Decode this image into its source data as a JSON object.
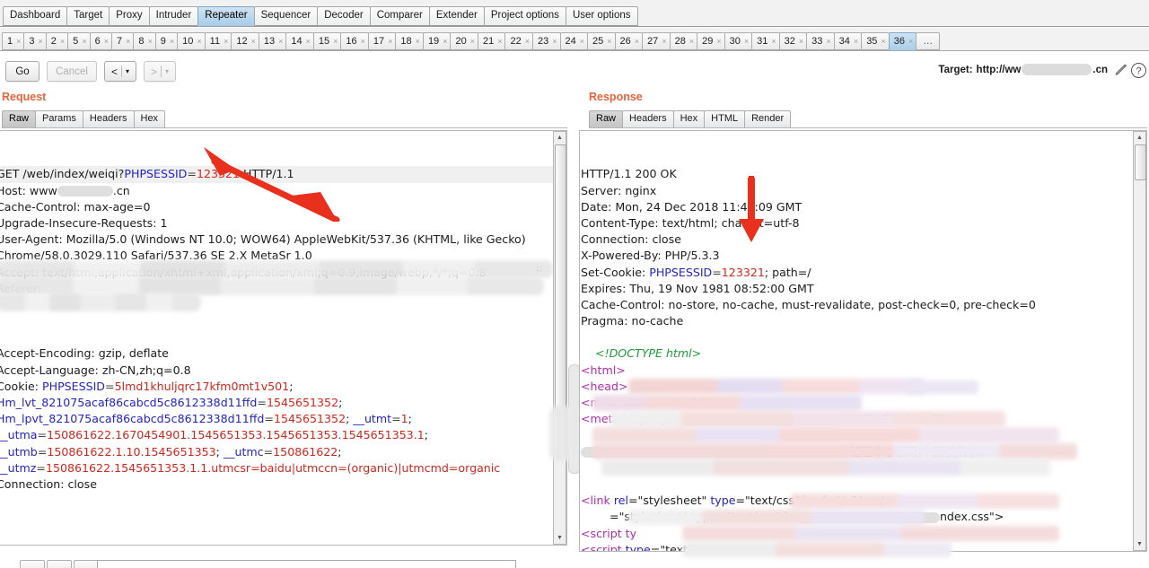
{
  "app": {
    "name": "Burp Suite Repeater"
  },
  "main_tabs": [
    {
      "label": "Dashboard",
      "selected": false
    },
    {
      "label": "Target",
      "selected": false
    },
    {
      "label": "Proxy",
      "selected": false
    },
    {
      "label": "Intruder",
      "selected": false
    },
    {
      "label": "Repeater",
      "selected": true
    },
    {
      "label": "Sequencer",
      "selected": false
    },
    {
      "label": "Decoder",
      "selected": false
    },
    {
      "label": "Comparer",
      "selected": false
    },
    {
      "label": "Extender",
      "selected": false
    },
    {
      "label": "Project options",
      "selected": false
    },
    {
      "label": "User options",
      "selected": false
    }
  ],
  "repeater_tabs": {
    "items": [
      {
        "label": "1",
        "selected": false
      },
      {
        "label": "3",
        "selected": false
      },
      {
        "label": "2",
        "selected": false
      },
      {
        "label": "5",
        "selected": false
      },
      {
        "label": "6",
        "selected": false
      },
      {
        "label": "7",
        "selected": false
      },
      {
        "label": "8",
        "selected": false
      },
      {
        "label": "9",
        "selected": false
      },
      {
        "label": "10",
        "selected": false
      },
      {
        "label": "11",
        "selected": false
      },
      {
        "label": "12",
        "selected": false
      },
      {
        "label": "13",
        "selected": false
      },
      {
        "label": "14",
        "selected": false
      },
      {
        "label": "15",
        "selected": false
      },
      {
        "label": "16",
        "selected": false
      },
      {
        "label": "17",
        "selected": false
      },
      {
        "label": "18",
        "selected": false
      },
      {
        "label": "19",
        "selected": false
      },
      {
        "label": "20",
        "selected": false
      },
      {
        "label": "21",
        "selected": false
      },
      {
        "label": "22",
        "selected": false
      },
      {
        "label": "23",
        "selected": false
      },
      {
        "label": "24",
        "selected": false
      },
      {
        "label": "25",
        "selected": false
      },
      {
        "label": "26",
        "selected": false
      },
      {
        "label": "27",
        "selected": false
      },
      {
        "label": "28",
        "selected": false
      },
      {
        "label": "29",
        "selected": false
      },
      {
        "label": "30",
        "selected": false
      },
      {
        "label": "31",
        "selected": false
      },
      {
        "label": "32",
        "selected": false
      },
      {
        "label": "33",
        "selected": false
      },
      {
        "label": "34",
        "selected": false
      },
      {
        "label": "35",
        "selected": false
      },
      {
        "label": "36",
        "selected": true
      }
    ],
    "close_glyph": "×",
    "overflow_label": "…"
  },
  "toolbar": {
    "go_label": "Go",
    "cancel_label": "Cancel",
    "cancel_disabled": true,
    "back_glyph": "<",
    "forward_glyph": ">",
    "caret_glyph": "▾",
    "target_label": "Target:",
    "target_prefix": "http://ww",
    "target_suffix": ".cn",
    "target_redacted": true
  },
  "request_panel": {
    "heading": "Request",
    "tabs": [
      {
        "label": "Raw",
        "selected": true
      },
      {
        "label": "Params",
        "selected": false
      },
      {
        "label": "Headers",
        "selected": false
      },
      {
        "label": "Hex",
        "selected": false
      }
    ],
    "lines": [
      {
        "id": "req-l1",
        "type": "requestline",
        "method": "GET ",
        "path": "/web/index/weiqi?",
        "param": "PHPSESSID",
        "eq": "=",
        "value": "123321",
        "proto": " HTTP/1.1"
      },
      {
        "id": "req-l2",
        "type": "host",
        "name": "Host: www",
        "suffix": ".cn"
      },
      {
        "id": "req-l3",
        "type": "plain",
        "text": "Cache-Control: max-age=0"
      },
      {
        "id": "req-l4",
        "type": "plain",
        "text": "Upgrade-Insecure-Requests: 1"
      },
      {
        "id": "req-l5",
        "type": "plain",
        "text": "User-Agent: Mozilla/5.0 (Windows NT 10.0; WOW64) AppleWebKit/537.36 (KHTML, like Gecko)"
      },
      {
        "id": "req-l6",
        "type": "plain",
        "text": "Chrome/58.0.3029.110 Safari/537.36 SE 2.X MetaSr 1.0"
      },
      {
        "id": "req-l7",
        "type": "plain",
        "text": "Accept: text/html,application/xhtml+xml,application/xml;q=0.9,image/webp,*/*;q=0.8"
      },
      {
        "id": "req-l8",
        "type": "plain",
        "text": "Referer:"
      },
      {
        "id": "req-l9",
        "type": "redacted",
        "text": ""
      },
      {
        "id": "req-l10",
        "type": "redacted",
        "text": ""
      },
      {
        "id": "req-l11",
        "type": "redacted",
        "text": ""
      },
      {
        "id": "req-l12",
        "type": "plain",
        "text": "Accept-Encoding: gzip, deflate"
      },
      {
        "id": "req-l13",
        "type": "plain",
        "text": "Accept-Language: zh-CN,zh;q=0.8"
      },
      {
        "id": "req-l14",
        "type": "cookie",
        "prefix": "Cookie: ",
        "name": "PHPSESSID",
        "eq": "=",
        "value": "5lmd1khuljqrc17kfm0mt1v501",
        "tail": ";"
      },
      {
        "id": "req-l15",
        "type": "cookie",
        "prefix": "",
        "name": "Hm_lvt_821075acaf86cabcd5c8612338d11ffd",
        "eq": "=",
        "value": "1545651352",
        "tail": ";"
      },
      {
        "id": "req-l16",
        "type": "cookie2",
        "name": "Hm_lpvt_821075acaf86cabcd5c8612338d11ffd",
        "eq": "=",
        "value": "1545651352",
        "mid": "; ",
        "name2": "__utmt",
        "eq2": "=",
        "value2": "1",
        "tail": ";"
      },
      {
        "id": "req-l17",
        "type": "cookie",
        "prefix": "",
        "name": "__utma",
        "eq": "=",
        "value": "150861622.1670454901.1545651353.1545651353.1545651353.1",
        "tail": ";"
      },
      {
        "id": "req-l18",
        "type": "cookie2",
        "name": "__utmb",
        "eq": "=",
        "value": "150861622.1.10.1545651353",
        "mid": "; ",
        "name2": "__utmc",
        "eq2": "=",
        "value2": "150861622",
        "tail": ";"
      },
      {
        "id": "req-l19",
        "type": "cookie",
        "prefix": "",
        "name": "__utmz",
        "eq": "=",
        "value": "150861622.1545651353.1.1.utmcsr=baidu|utmccn=(organic)|utmcmd=organic",
        "tail": ""
      },
      {
        "id": "req-l20",
        "type": "plain",
        "text": "Connection: close"
      }
    ]
  },
  "response_panel": {
    "heading": "Response",
    "tabs": [
      {
        "label": "Raw",
        "selected": true
      },
      {
        "label": "Headers",
        "selected": false
      },
      {
        "label": "Hex",
        "selected": false
      },
      {
        "label": "HTML",
        "selected": false
      },
      {
        "label": "Render",
        "selected": false
      }
    ],
    "lines": [
      {
        "id": "res-l1",
        "type": "plain",
        "text": "HTTP/1.1 200 OK"
      },
      {
        "id": "res-l2",
        "type": "plain",
        "text": "Server: nginx"
      },
      {
        "id": "res-l3",
        "type": "plain",
        "text": "Date: Mon, 24 Dec 2018 11:46:09 GMT"
      },
      {
        "id": "res-l4",
        "type": "plain",
        "text": "Content-Type: text/html; charset=utf-8"
      },
      {
        "id": "res-l5",
        "type": "plain",
        "text": "Connection: close"
      },
      {
        "id": "res-l6",
        "type": "plain",
        "text": "X-Powered-By: PHP/5.3.3"
      },
      {
        "id": "res-l7",
        "type": "setcookie",
        "prefix": "Set-Cookie: ",
        "name": "PHPSESSID",
        "eq": "=",
        "value": "123321",
        "tail": "; path=/"
      },
      {
        "id": "res-l8",
        "type": "plain",
        "text": "Expires: Thu, 19 Nov 1981 08:52:00 GMT"
      },
      {
        "id": "res-l9",
        "type": "plain",
        "text": "Cache-Control: no-store, no-cache, must-revalidate, post-check=0, pre-check=0"
      },
      {
        "id": "res-l10",
        "type": "plain",
        "text": "Pragma: no-cache"
      },
      {
        "id": "res-l11",
        "type": "blank",
        "text": ""
      },
      {
        "id": "res-l12",
        "type": "doctype",
        "text": "    <!DOCTYPE html>"
      },
      {
        "id": "res-l13",
        "type": "tag",
        "text": "<html>"
      },
      {
        "id": "res-l14",
        "type": "tag",
        "text": "<head>"
      },
      {
        "id": "res-l15",
        "type": "metacharset",
        "tag": "<meta ",
        "attr": "charset",
        "val": "=\"utf-8\"/>"
      },
      {
        "id": "res-l16",
        "type": "metahttp",
        "tag": "<meta ",
        "attr": "http-equiv",
        "tail": "t=\"IE=EmulateIE9\">"
      },
      {
        "id": "res-l17",
        "type": "redacted",
        "text": ""
      },
      {
        "id": "res-l18",
        "type": "redactedcn",
        "text": "管理中心官网,中国棋院\"/>"
      },
      {
        "id": "res-l19",
        "type": "redacted",
        "text": ""
      },
      {
        "id": "res-l20",
        "type": "redacted",
        "text": ""
      },
      {
        "id": "res-l21",
        "type": "link",
        "tag": "<link ",
        "a1": "rel",
        "v1": "=\"stylesheet\" ",
        "a2": "type",
        "v2": "=\"text/css\" ",
        "a3": "href",
        "v3": "=\"/v2/css/"
      },
      {
        "id": "res-l22",
        "type": "link2",
        "text": "=\"stylesheet\" type=\"text/css\" hr",
        "tail": "ndex.css\">"
      },
      {
        "id": "res-l23",
        "type": "script",
        "text": "<script ty"
      },
      {
        "id": "res-l24",
        "type": "script2",
        "tag": "<script ",
        "attr": "type",
        "val": "=\"text/j"
      }
    ]
  },
  "annotations": {
    "arrow_request_target": "123321",
    "arrow_response_target": "123321",
    "arrow_color": "#e8301c"
  },
  "search_bar": {
    "buttons": [
      "",
      "",
      ""
    ],
    "input_value": ""
  }
}
